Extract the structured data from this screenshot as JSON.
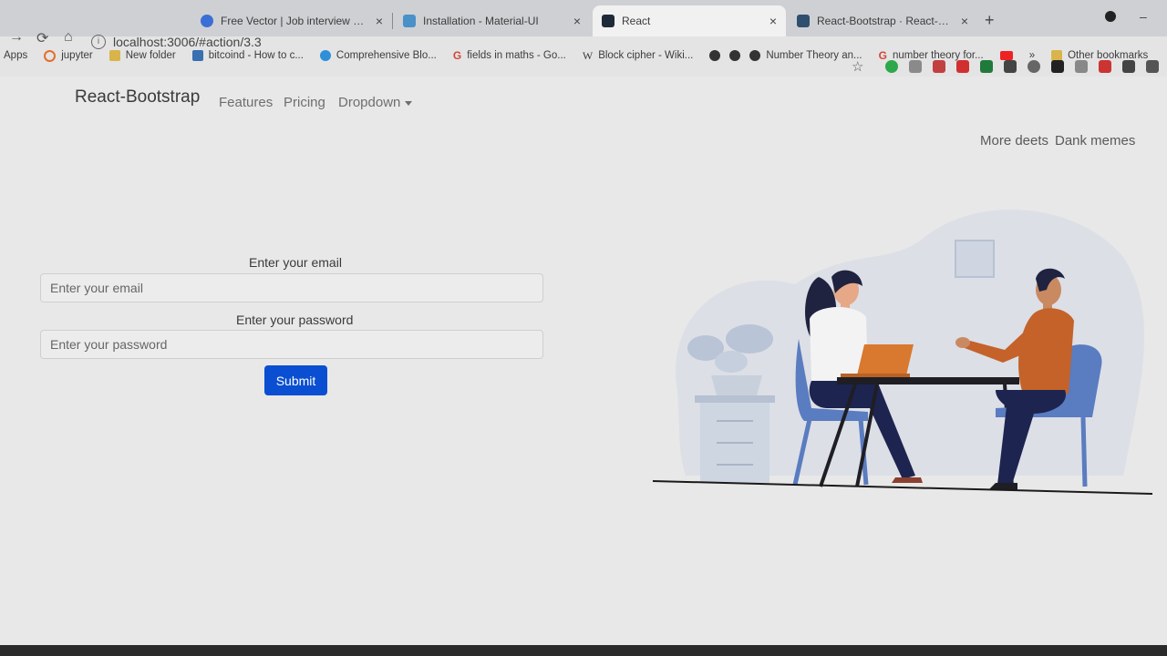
{
  "tabs": [
    {
      "title": "Free Vector | Job interview conve",
      "close": "×"
    },
    {
      "title": "Installation - Material-UI",
      "close": "×"
    },
    {
      "title": "React",
      "close": "×"
    },
    {
      "title": "React-Bootstrap · React-Bootstr",
      "close": "×"
    }
  ],
  "new_tab": "+",
  "address": "localhost:3006/#action/3.3",
  "bookmarks": [
    {
      "label": "Apps",
      "icon": "apps-grid-icon"
    },
    {
      "label": "jupyter",
      "icon": "jupyter-icon"
    },
    {
      "label": "New folder",
      "icon": "folder-icon"
    },
    {
      "label": "bitcoind - How to c...",
      "icon": "site-icon"
    },
    {
      "label": "Comprehensive Blo...",
      "icon": "globe-icon"
    },
    {
      "label": "fields in maths - Go...",
      "icon": "google-icon"
    },
    {
      "label": "Block cipher - Wiki...",
      "icon": "wikipedia-icon"
    },
    {
      "label": "",
      "icon": "globe-icon"
    },
    {
      "label": "",
      "icon": "globe-icon"
    },
    {
      "label": "Number Theory an...",
      "icon": "globe-icon"
    },
    {
      "label": "number theory for...",
      "icon": "google-icon"
    },
    {
      "label": "",
      "icon": "youtube-icon"
    },
    {
      "label": "»",
      "icon": ""
    },
    {
      "label": "Other bookmarks",
      "icon": "folder-icon"
    }
  ],
  "navbar": {
    "brand": "React-Bootstrap",
    "features": "Features",
    "pricing": "Pricing",
    "dropdown": "Dropdown",
    "more_deets": "More deets",
    "dank_memes": "Dank memes"
  },
  "form": {
    "email_label": "Enter your email",
    "email_placeholder": "Enter your email",
    "password_label": "Enter your password",
    "password_placeholder": "Enter your password",
    "submit": "Submit"
  },
  "colors": {
    "submit_bg": "#0a4fd1",
    "jacket": "#c4622a",
    "laptop": "#d9782f",
    "chair": "#5a7cc0"
  }
}
